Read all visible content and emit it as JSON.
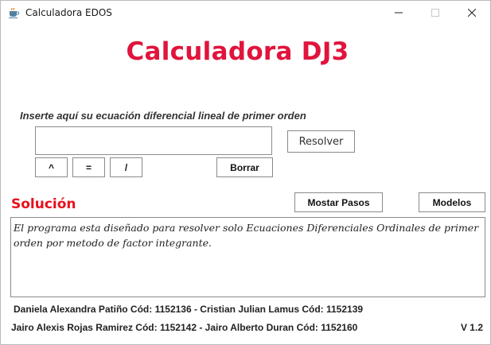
{
  "window": {
    "title": "Calculadora EDOS"
  },
  "header": {
    "title": "Calculadora DJ3"
  },
  "input_section": {
    "prompt": "Inserte aquí su ecuación diferencial lineal de primer orden",
    "equation_value": "",
    "resolver_label": "Resolver",
    "caret_label": "^",
    "equals_label": "=",
    "slash_label": "/",
    "borrar_label": "Borrar"
  },
  "solution_section": {
    "heading": "Solución",
    "mostrar_pasos_label": "Mostar Pasos",
    "modelos_label": "Modelos",
    "output_text": "El programa esta diseñado para resolver solo Ecuaciones Diferenciales Ordinales de primer orden por metodo de factor integrante."
  },
  "footer": {
    "credits_line1": "Daniela Alexandra Patiño Cód: 1152136 - Cristian Julian Lamus Cód: 1152139",
    "credits_line2": "Jairo Alexis Rojas Ramirez Cód: 1152142 - Jairo Alberto Duran Cód: 1152160",
    "version": "V 1.2"
  },
  "colors": {
    "accent_title": "#e0143c",
    "accent_solution": "#e8101c"
  },
  "icons": {
    "app": "java-cup-icon",
    "minimize": "minimize-icon",
    "maximize": "maximize-icon",
    "close": "close-icon"
  }
}
